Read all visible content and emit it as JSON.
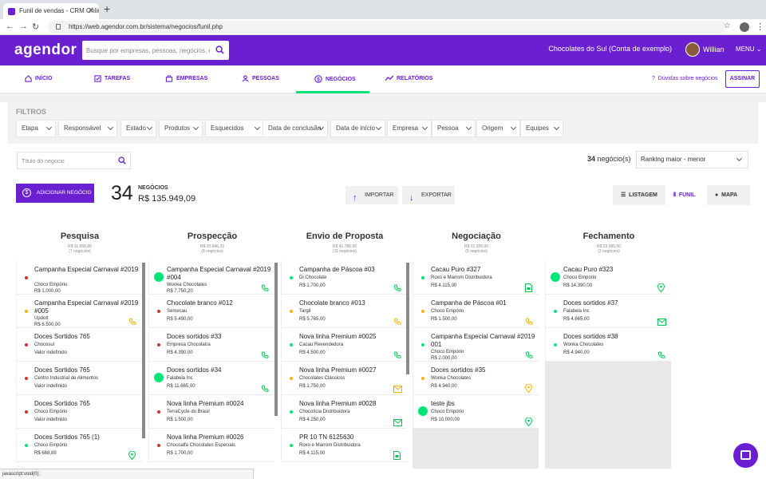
{
  "browser": {
    "tab_title": "Funil de vendas - CRM Online",
    "url": "https://web.agendor.com.br/sistema/negocios/funil.php",
    "status_text": "javascript:void(0);"
  },
  "app": {
    "logo": "agendor",
    "search_placeholder": "Busque por empresas, pessoas, negócios, etc...",
    "company": "Chocolates do Sul (Conta de exemplo)",
    "user": "Willian",
    "menu": "MENU",
    "brand_color": "#6a1fd0"
  },
  "nav": {
    "items": [
      {
        "label": "INÍCIO",
        "icon": "home-icon"
      },
      {
        "label": "TAREFAS",
        "icon": "checkbox-icon"
      },
      {
        "label": "EMPRESAS",
        "icon": "building-icon"
      },
      {
        "label": "PESSOAS",
        "icon": "person-icon"
      },
      {
        "label": "NEGÓCIOS",
        "icon": "dollar-icon"
      },
      {
        "label": "RELATÓRIOS",
        "icon": "chart-line-icon"
      }
    ],
    "help": "Dúvidas sobre negócios",
    "subscribe": "ASSINAR"
  },
  "filters": {
    "title": "FILTROS",
    "items": [
      "Etapa",
      "Responsável",
      "Estado",
      "Produtos",
      "Esquecidos",
      "Data de conclusão",
      "Data de início",
      "Empresa",
      "Pessoa",
      "Origem",
      "Equipes"
    ]
  },
  "toolbar": {
    "title_search_placeholder": "Título do negócio",
    "count_number": "34",
    "count_label": "negócio(s)",
    "ranking": "Ranking maior - menor",
    "add_button": "ADICIONAR NEGÓCIO",
    "big_number": "34",
    "negocios_label": "NEGÓCIOS",
    "total": "R$ 135.949,09",
    "import": "IMPORTAR",
    "export": "EXPORTAR",
    "views": [
      "LISTAGEM",
      "FUNIL",
      "MAPA"
    ]
  },
  "columns": [
    {
      "title": "Pesquisa",
      "total": "R$ 11.668,89",
      "count": "(7 negócios)",
      "cards": [
        {
          "title": "Campanha Especial Carnaval #2019",
          "company": "Choco Empório",
          "value": "R$ 1.000,00",
          "dot": "red",
          "icon": ""
        },
        {
          "title": "Campanha Especial Carnaval #2019 #005",
          "company": "Updott",
          "value": "R$ 6.500,00",
          "dot": "yellow",
          "icon": "phone-icon"
        },
        {
          "title": "Doces Sortidos 765",
          "company": "Chocosul",
          "value": "Valor indefinido",
          "dot": "red",
          "icon": ""
        },
        {
          "title": "Doces Sortidos 765",
          "company": "Centro Industrial de Alimentos",
          "value": "Valor indefinido",
          "dot": "red",
          "icon": ""
        },
        {
          "title": "Doces Sortidos 765",
          "company": "Choco Empório",
          "value": "Valor indefinido",
          "dot": "red",
          "icon": ""
        },
        {
          "title": "Doces Sortidos 765 (1)",
          "company": "Choco Empório",
          "value": "R$ 668,89",
          "dot": "green",
          "icon": "map-pin-icon"
        }
      ]
    },
    {
      "title": "Prospecção",
      "total": "R$ 35.946,20",
      "count": "(8 negócios)",
      "cards": [
        {
          "title": "Campanha Especial Carnaval #2019 #004",
          "company": "Wonka Chocolates",
          "value": "R$ 7.750,20",
          "dot": "biggreen",
          "icon": "phone-icon"
        },
        {
          "title": "Chocolate branco #012",
          "company": "Semecau",
          "value": "R$ 5.490,00",
          "dot": "red",
          "icon": ""
        },
        {
          "title": "Doces sortidos #33",
          "company": "Empresa Chocolatra",
          "value": "R$ 4.390,00",
          "dot": "red",
          "icon": "phone-icon"
        },
        {
          "title": "Doces sortidos #34",
          "company": "Falabela Inc",
          "value": "R$ 11.665,00",
          "dot": "biggreen",
          "icon": "phone-icon"
        },
        {
          "title": "Nova linha Premium #0024",
          "company": "TerraCycle do Brasil",
          "value": "R$ 1.500,00",
          "dot": "red",
          "icon": ""
        },
        {
          "title": "Nova linha Premium #0026",
          "company": "Chocoalfa Chocolates Especiais",
          "value": "R$ 1.700,00",
          "dot": "red",
          "icon": ""
        }
      ]
    },
    {
      "title": "Envio de Proposta",
      "total": "R$ 41.785,00",
      "count": "(11 negócios)",
      "cards": [
        {
          "title": "Campanha de Páscoa #03",
          "company": "Di Chocolate",
          "value": "R$ 1.700,00",
          "dot": "green",
          "icon": "phone-icon"
        },
        {
          "title": "Chocolate branco #013",
          "company": "Targil",
          "value": "R$ 5.765,00",
          "dot": "yellow",
          "icon": "phone-icon"
        },
        {
          "title": "Nova linha Premium #0025",
          "company": "Cacau Revendedora",
          "value": "R$ 4.500,00",
          "dot": "green",
          "icon": "phone-icon"
        },
        {
          "title": "Nova linha Premium #0027",
          "company": "Chocolates Clássicos",
          "value": "R$ 1.750,00",
          "dot": "yellow",
          "icon": "mail-icon"
        },
        {
          "title": "Nova linha Premium #0028",
          "company": "Chocolícia Distribuidora",
          "value": "R$ 4.250,00",
          "dot": "green",
          "icon": "mail-icon"
        },
        {
          "title": "PR 10 TN 6125630",
          "company": "Roxo e Marrom Distribuidora",
          "value": "R$ 4.115,00",
          "dot": "green",
          "icon": "document-icon"
        }
      ]
    },
    {
      "title": "Negociação",
      "total": "R$ 22.555,00",
      "count": "(5 negócios)",
      "cards": [
        {
          "title": "Cacau Puro #327",
          "company": "Roxo e Marrom Distribuidora",
          "value": "R$ 4.115,00",
          "dot": "green",
          "icon": "document-icon"
        },
        {
          "title": "Campanha de Páscoa #01",
          "company": "Choco Empório",
          "value": "R$ 1.500,00",
          "dot": "yellow",
          "icon": "phone-icon"
        },
        {
          "title": "Campanha Especial Carnaval #2019 001",
          "company": "Choco Empório",
          "value": "R$ 2.000,00",
          "dot": "green",
          "icon": "phone-icon"
        },
        {
          "title": "Doces sortidos #35",
          "company": "Wonka Chocolates",
          "value": "R$ 4.940,00",
          "dot": "yellow",
          "icon": "map-pin-icon"
        },
        {
          "title": "teste jbs",
          "company": "Choco Empório",
          "value": "R$ 10.000,00",
          "dot": "biggreen",
          "icon": "map-pin-icon"
        }
      ]
    },
    {
      "title": "Fechamento",
      "total": "R$ 23.995,00",
      "count": "(3 negócios)",
      "cards": [
        {
          "title": "Cacau Puro #323",
          "company": "Choco Empório",
          "value": "R$ 14.390,00",
          "dot": "biggreen",
          "icon": "map-pin-icon"
        },
        {
          "title": "Doces sortidos #37",
          "company": "Falabela Inc",
          "value": "R$ 4.665,00",
          "dot": "green",
          "icon": "mail-icon"
        },
        {
          "title": "Doces sortidos #38",
          "company": "Wonka Chocolates",
          "value": "R$ 4.940,00",
          "dot": "green",
          "icon": "phone-icon"
        }
      ]
    }
  ],
  "status_colors": {
    "red": "#d32f2f",
    "yellow": "#f4b400",
    "green": "#00e676",
    "icon_green": "#00c853",
    "icon_yellow": "#f4b400"
  }
}
